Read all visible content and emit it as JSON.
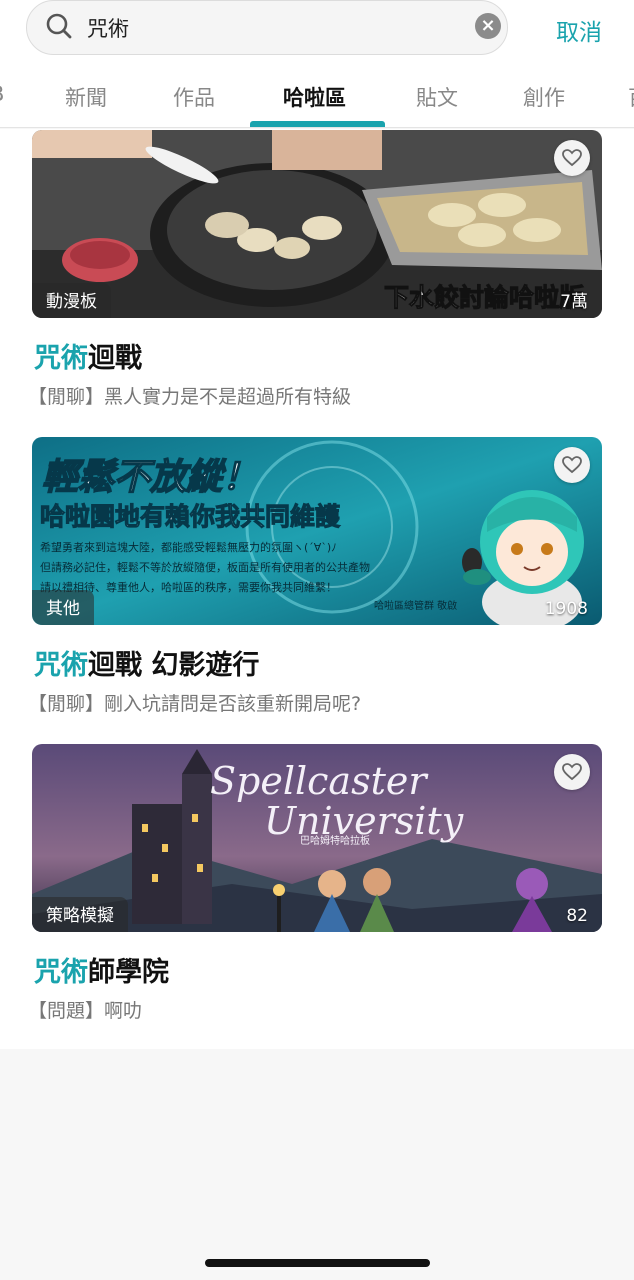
{
  "search": {
    "query": "咒術",
    "cancel_label": "取消"
  },
  "tabs": [
    {
      "label": "B"
    },
    {
      "label": "新聞"
    },
    {
      "label": "作品"
    },
    {
      "label": "哈啦區"
    },
    {
      "label": "貼文"
    },
    {
      "label": "創作"
    },
    {
      "label": "百"
    }
  ],
  "active_tab": "哈啦區",
  "accent_color": "#1aa3ad",
  "results": [
    {
      "board": "動漫板",
      "count": "7萬",
      "banner_text": "下水餃討論哈啦版",
      "title_highlight": "咒術",
      "title_rest": "迴戰",
      "subtitle": "【閒聊】黑人實力是不是超過所有特級"
    },
    {
      "board": "其他",
      "count": "1908",
      "banner_heading_1": "輕鬆不放縱！",
      "banner_heading_2": "哈啦園地有賴你我共同維護",
      "banner_line_1": "希望勇者來到這塊大陸，都能感受輕鬆無壓力的氛圍ヽ(´∀`)ﾉ",
      "banner_line_2": "但請務必記住，輕鬆不等於放縱隨便，板面是所有使用者的公共產物",
      "banner_line_3": "請以禮相待、尊重他人，哈啦區的秩序，需要你我共同維繫！",
      "banner_footer": "哈啦區總管群 敬啟",
      "title_highlight": "咒術",
      "title_rest": "迴戰 幻影遊行",
      "subtitle": "【閒聊】剛入坑請問是否該重新開局呢?"
    },
    {
      "board": "策略模擬",
      "count": "82",
      "banner_title_1": "Spellcaster",
      "banner_title_2": "University",
      "banner_caption": "巴哈姆特哈拉板",
      "title_highlight": "咒術",
      "title_rest": "師學院",
      "subtitle": "【問題】啊叻"
    }
  ]
}
